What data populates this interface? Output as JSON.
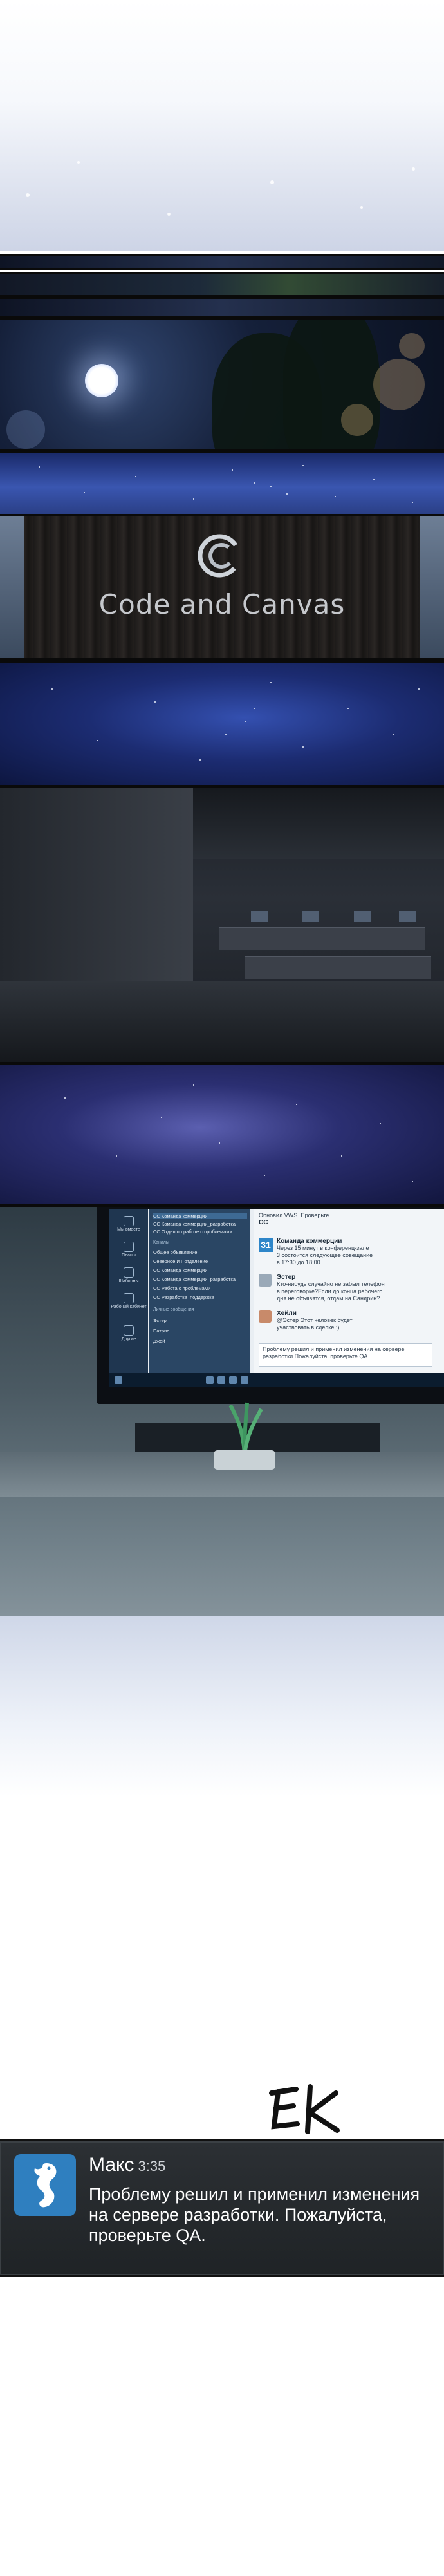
{
  "logo": {
    "title": "Code and Canvas",
    "subtitle": ""
  },
  "messenger": {
    "rail": [
      {
        "label": "Мы вместе",
        "icon": "bell-icon"
      },
      {
        "label": "Планы",
        "icon": "calendar-icon"
      },
      {
        "label": "Шаблоны",
        "icon": "flag-icon"
      },
      {
        "label": "Рабочий кабинет",
        "icon": "chat-icon"
      },
      {
        "label": "Другие",
        "icon": "more-icon"
      }
    ],
    "channels": [
      "CC Команда коммерции",
      "CC Команда коммерции_разработка",
      "CC Отдел по работе с проблемами",
      "Каналы",
      "Общее объявление",
      "Северное ИТ отделение",
      "CC Команда коммерции",
      "CC Команда коммерции_разработка",
      "CC Работа с проблемами",
      "CC Разработка_поддержка",
      "Личные сообщения",
      "Эстер",
      "Патрис",
      "Джой"
    ],
    "chat_top_line": "Обновил VWS. Проверьте",
    "chat_top_name": "CC",
    "messages": [
      {
        "name": "Команда коммерции",
        "lines": [
          "Через 15 минут в конференц-зале",
          "3 состоится следующее совещание",
          "в 17:30 до 18:00"
        ],
        "avatar": "31"
      },
      {
        "name": "Эстер",
        "lines": [
          "Кто-нибудь случайно не забыл телефон",
          "в переговорке?Если до конца рабочего",
          "дня не объявятся, отдам на Сандрин?"
        ],
        "avatar": ""
      },
      {
        "name": "Хейли",
        "lines": [
          "@Эстер Этот человек будет",
          "участвовать в сделке :)"
        ],
        "avatar": ""
      }
    ],
    "composer_text": "Проблему решил и применил изменения на сервере разработки Пожалуйста, проверьте QA."
  },
  "sfx": "Ek",
  "notification": {
    "sender": "Макс",
    "time": "3:35",
    "message": "Проблему решил и применил изменения на сервере разработки. Пожалуйста, проверьте QA."
  }
}
